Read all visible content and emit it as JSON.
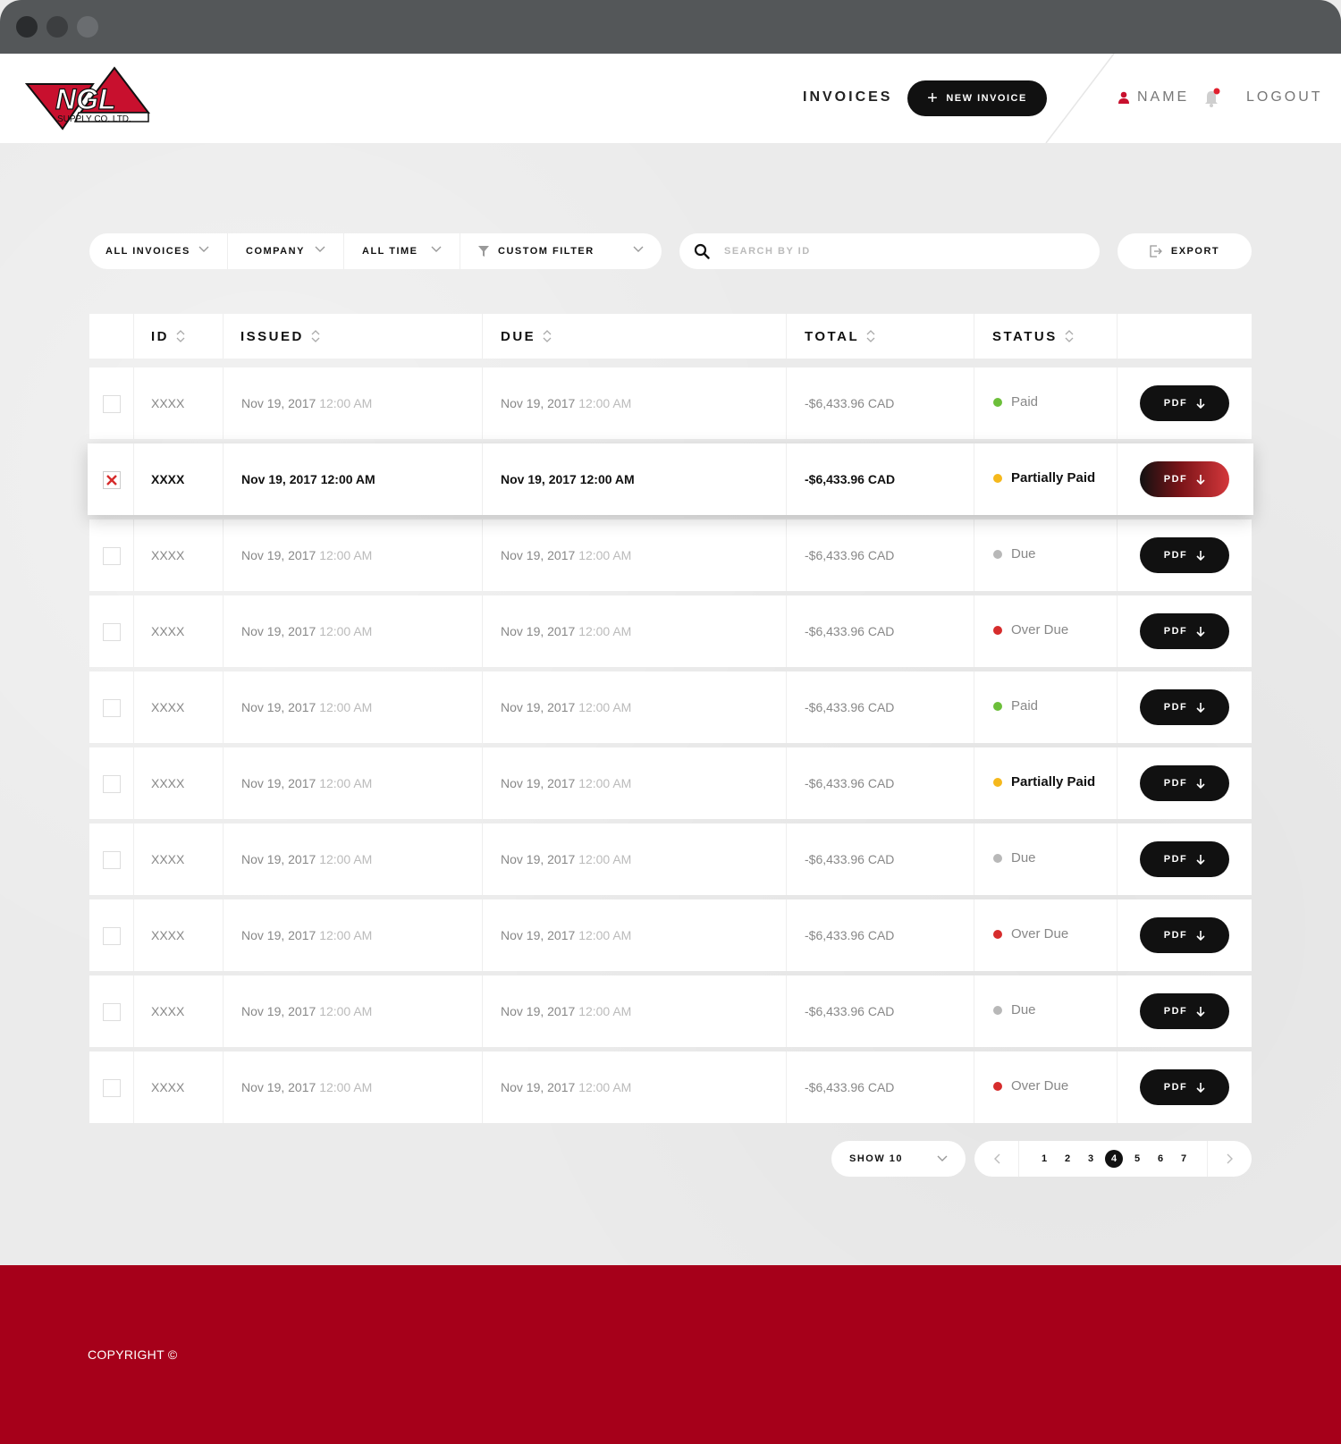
{
  "header": {
    "logo_text": "NGL",
    "logo_sub": "SUPPLY CO. LTD.",
    "nav_invoices": "INVOICES",
    "new_invoice_label": "NEW INVOICE",
    "user_label": "NAME",
    "logout_label": "LOGOUT"
  },
  "filters": {
    "all_invoices": "ALL INVOICES",
    "company": "COMPANY",
    "all_time": "ALL TIME",
    "custom_filter": "CUSTOM FILTER"
  },
  "search": {
    "placeholder": "SEARCH BY ID"
  },
  "export_label": "EXPORT",
  "table": {
    "columns": [
      "ID",
      "ISSUED",
      "DUE",
      "TOTAL",
      "STATUS"
    ],
    "pdf_label": "PDF",
    "rows": [
      {
        "id": "XXXX",
        "issued_date": "Nov 19, 2017",
        "issued_time": "12:00 AM",
        "due_date": "Nov 19, 2017",
        "due_time": "12:00 AM",
        "total": "-$6,433.96 CAD",
        "status": "Paid",
        "checked": false
      },
      {
        "id": "XXXX",
        "issued_date": "Nov 19, 2017",
        "issued_time": "12:00 AM",
        "due_date": "Nov 19, 2017",
        "due_time": "12:00 AM",
        "total": "-$6,433.96 CAD",
        "status": "Partially Paid",
        "checked": true
      },
      {
        "id": "XXXX",
        "issued_date": "Nov 19, 2017",
        "issued_time": "12:00 AM",
        "due_date": "Nov 19, 2017",
        "due_time": "12:00 AM",
        "total": "-$6,433.96 CAD",
        "status": "Due",
        "checked": false
      },
      {
        "id": "XXXX",
        "issued_date": "Nov 19, 2017",
        "issued_time": "12:00 AM",
        "due_date": "Nov 19, 2017",
        "due_time": "12:00 AM",
        "total": "-$6,433.96 CAD",
        "status": "Over Due",
        "checked": false
      },
      {
        "id": "XXXX",
        "issued_date": "Nov 19, 2017",
        "issued_time": "12:00 AM",
        "due_date": "Nov 19, 2017",
        "due_time": "12:00 AM",
        "total": "-$6,433.96 CAD",
        "status": "Paid",
        "checked": false
      },
      {
        "id": "XXXX",
        "issued_date": "Nov 19, 2017",
        "issued_time": "12:00 AM",
        "due_date": "Nov 19, 2017",
        "due_time": "12:00 AM",
        "total": "-$6,433.96 CAD",
        "status": "Partially Paid",
        "checked": false
      },
      {
        "id": "XXXX",
        "issued_date": "Nov 19, 2017",
        "issued_time": "12:00 AM",
        "due_date": "Nov 19, 2017",
        "due_time": "12:00 AM",
        "total": "-$6,433.96 CAD",
        "status": "Due",
        "checked": false
      },
      {
        "id": "XXXX",
        "issued_date": "Nov 19, 2017",
        "issued_time": "12:00 AM",
        "due_date": "Nov 19, 2017",
        "due_time": "12:00 AM",
        "total": "-$6,433.96 CAD",
        "status": "Over Due",
        "checked": false
      },
      {
        "id": "XXXX",
        "issued_date": "Nov 19, 2017",
        "issued_time": "12:00 AM",
        "due_date": "Nov 19, 2017",
        "due_time": "12:00 AM",
        "total": "-$6,433.96 CAD",
        "status": "Due",
        "checked": false
      },
      {
        "id": "XXXX",
        "issued_date": "Nov 19, 2017",
        "issued_time": "12:00 AM",
        "due_date": "Nov 19, 2017",
        "due_time": "12:00 AM",
        "total": "-$6,433.96 CAD",
        "status": "Over Due",
        "checked": false
      }
    ]
  },
  "status_colors": {
    "Paid": "#6cbf3a",
    "Partially Paid": "#f5b81c",
    "Due": "#b8b8b8",
    "Over Due": "#d62c2c"
  },
  "pagination": {
    "show_label": "SHOW 10",
    "pages": [
      "1",
      "2",
      "3",
      "4",
      "5",
      "6",
      "7"
    ],
    "current": "4"
  },
  "footer": {
    "copyright": "COPYRIGHT ©"
  },
  "colors": {
    "brand_red": "#a6001a",
    "accent_dark": "#111111"
  }
}
